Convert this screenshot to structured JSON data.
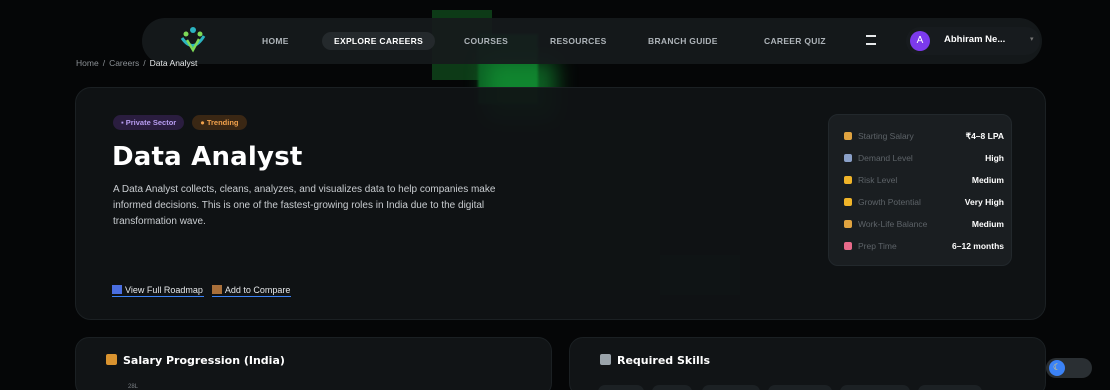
{
  "nav": {
    "items": [
      {
        "label": "HOME",
        "active": false
      },
      {
        "label": "EXPLORE CAREERS",
        "active": true
      },
      {
        "label": "COURSES",
        "active": false
      },
      {
        "label": "RESOURCES",
        "active": false
      },
      {
        "label": "BRANCH GUIDE",
        "active": false
      },
      {
        "label": "CAREER QUIZ",
        "active": false
      }
    ],
    "user": {
      "initial": "A",
      "name": "Abhiram Ne..."
    }
  },
  "breadcrumb": [
    "Home",
    "Careers",
    "Data Analyst"
  ],
  "hero": {
    "tags": [
      "Private Sector",
      "Trending"
    ],
    "title": "Data Analyst",
    "description": "A Data Analyst collects, cleans, analyzes, and visualizes data to help companies make informed decisions. This is one of the fastest-growing roles in India due to the digital transformation wave.",
    "actions": [
      "View Full Roadmap",
      "Add to Compare"
    ]
  },
  "stats": [
    {
      "label": "Starting Salary",
      "value": "₹4–8 LPA",
      "icon": "money-bag-icon",
      "color": "#e0a340"
    },
    {
      "label": "Demand Level",
      "value": "High",
      "icon": "chart-icon",
      "color": "#8aa0c8"
    },
    {
      "label": "Risk Level",
      "value": "Medium",
      "icon": "lightning-icon",
      "color": "#f0b429"
    },
    {
      "label": "Growth Potential",
      "value": "Very High",
      "icon": "trophy-icon",
      "color": "#f0b429"
    },
    {
      "label": "Work-Life Balance",
      "value": "Medium",
      "icon": "scale-icon",
      "color": "#e0a340"
    },
    {
      "label": "Prep Time",
      "value": "6–12 months",
      "icon": "hourglass-icon",
      "color": "#e86a8a"
    }
  ],
  "salary_card": {
    "title": "Salary Progression (India)",
    "axis_tick": "28L"
  },
  "skills_card": {
    "title": "Required Skills"
  }
}
